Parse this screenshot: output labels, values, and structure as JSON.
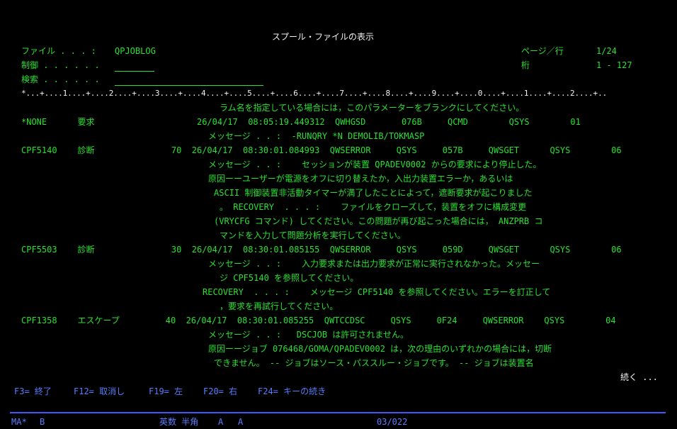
{
  "header": {
    "title": "スプール・ファイルの表示",
    "file_label": "ファイル . . . :",
    "file_value": "QPJOBLOG",
    "control_label": "制御 . . . . . .",
    "search_label": "検索 . . . . . .",
    "page_line_label": "ページ／行",
    "page_line_value": "1/24",
    "column_label": "桁",
    "column_value": "1 - 127"
  },
  "ruler": "*...+....1....+....2....+....3....+....4....+....5....+....6....+....7....+....8....+....9....+....0....+....1....+....2....+..",
  "log_lines": [
    "ラム名を指定している場合には，このパラメーターをブランクにしてください。",
    "*NONE      要求                    26/04/17  08:05:19.449312  QWHGSD       076B     QCMD        QSYS        01",
    "メッセージ . . :  -RUNQRY *N DEMOLIB/TOKMASP",
    "CPF5140    診断               70  26/04/17  08:30:01.084993  QWSERROR     QSYS     057B     QWSGET      QSYS        06",
    "メッセージ . . :    セッションが装置 QPADEV0002 からの要求により停止した。",
    "原因ーーユーザーが電源をオフに切り替えたか，入出力装置エラーか，あるいは",
    "ASCII 制御装置非活動タイマーが満了したことによって，遮断要求が起こりました",
    "。 RECOVERY  . . . :    ファイルをクローズして，装置をオフに構成変更",
    "(VRYCFG コマンド) してください。この問題が再び起こった場合には， ANZPRB コ",
    "マンドを入力して問題分析を実行してください。",
    "CPF5503    診断               30  26/04/17  08:30:01.085155  QWSERROR     QSYS     059D     QWSGET      QSYS        06",
    "メッセージ . . :    入力要求または出力要求が正常に実行されなかった。メッセー",
    "ジ CPF5140 を参照してください。",
    "RECOVERY  . . . :    メッセージ CPF5140 を参照してください。エラーを訂正して",
    "，要求を再試行してください。",
    "CPF1358    エスケープ         40  26/04/17  08:30:01.085255  QWTCCDSC     QSYS     0F24     QWSERROR    QSYS        04",
    "メッセージ . . :   DSCJOB は許可されません。",
    "原因ーージョブ 076468/GOMA/QPADEV0002 は，次の理由のいずれかの場合には，切断",
    "できません。 -- ジョブはソース・パススルー・ジョブです。 -- ジョブは装置名"
  ],
  "more_indicator": "続く ...",
  "function_keys": [
    {
      "label": "F3= 終了"
    },
    {
      "label": "F12= 取消し"
    },
    {
      "label": "F19= 左"
    },
    {
      "label": "F20= 右"
    },
    {
      "label": "F24= キーの続き"
    }
  ],
  "status_bar": {
    "session": "MA*",
    "indicator": "B",
    "input_mode": "英数 半角",
    "flag1": "A",
    "flag2": "A",
    "cursor_pos": "03/022"
  },
  "colors": {
    "background": "#000000",
    "field_text": "#29e02f",
    "title_text": "#f2f2f2",
    "function_key_text": "#5a7dff",
    "status_rule": "#3a5cff"
  }
}
